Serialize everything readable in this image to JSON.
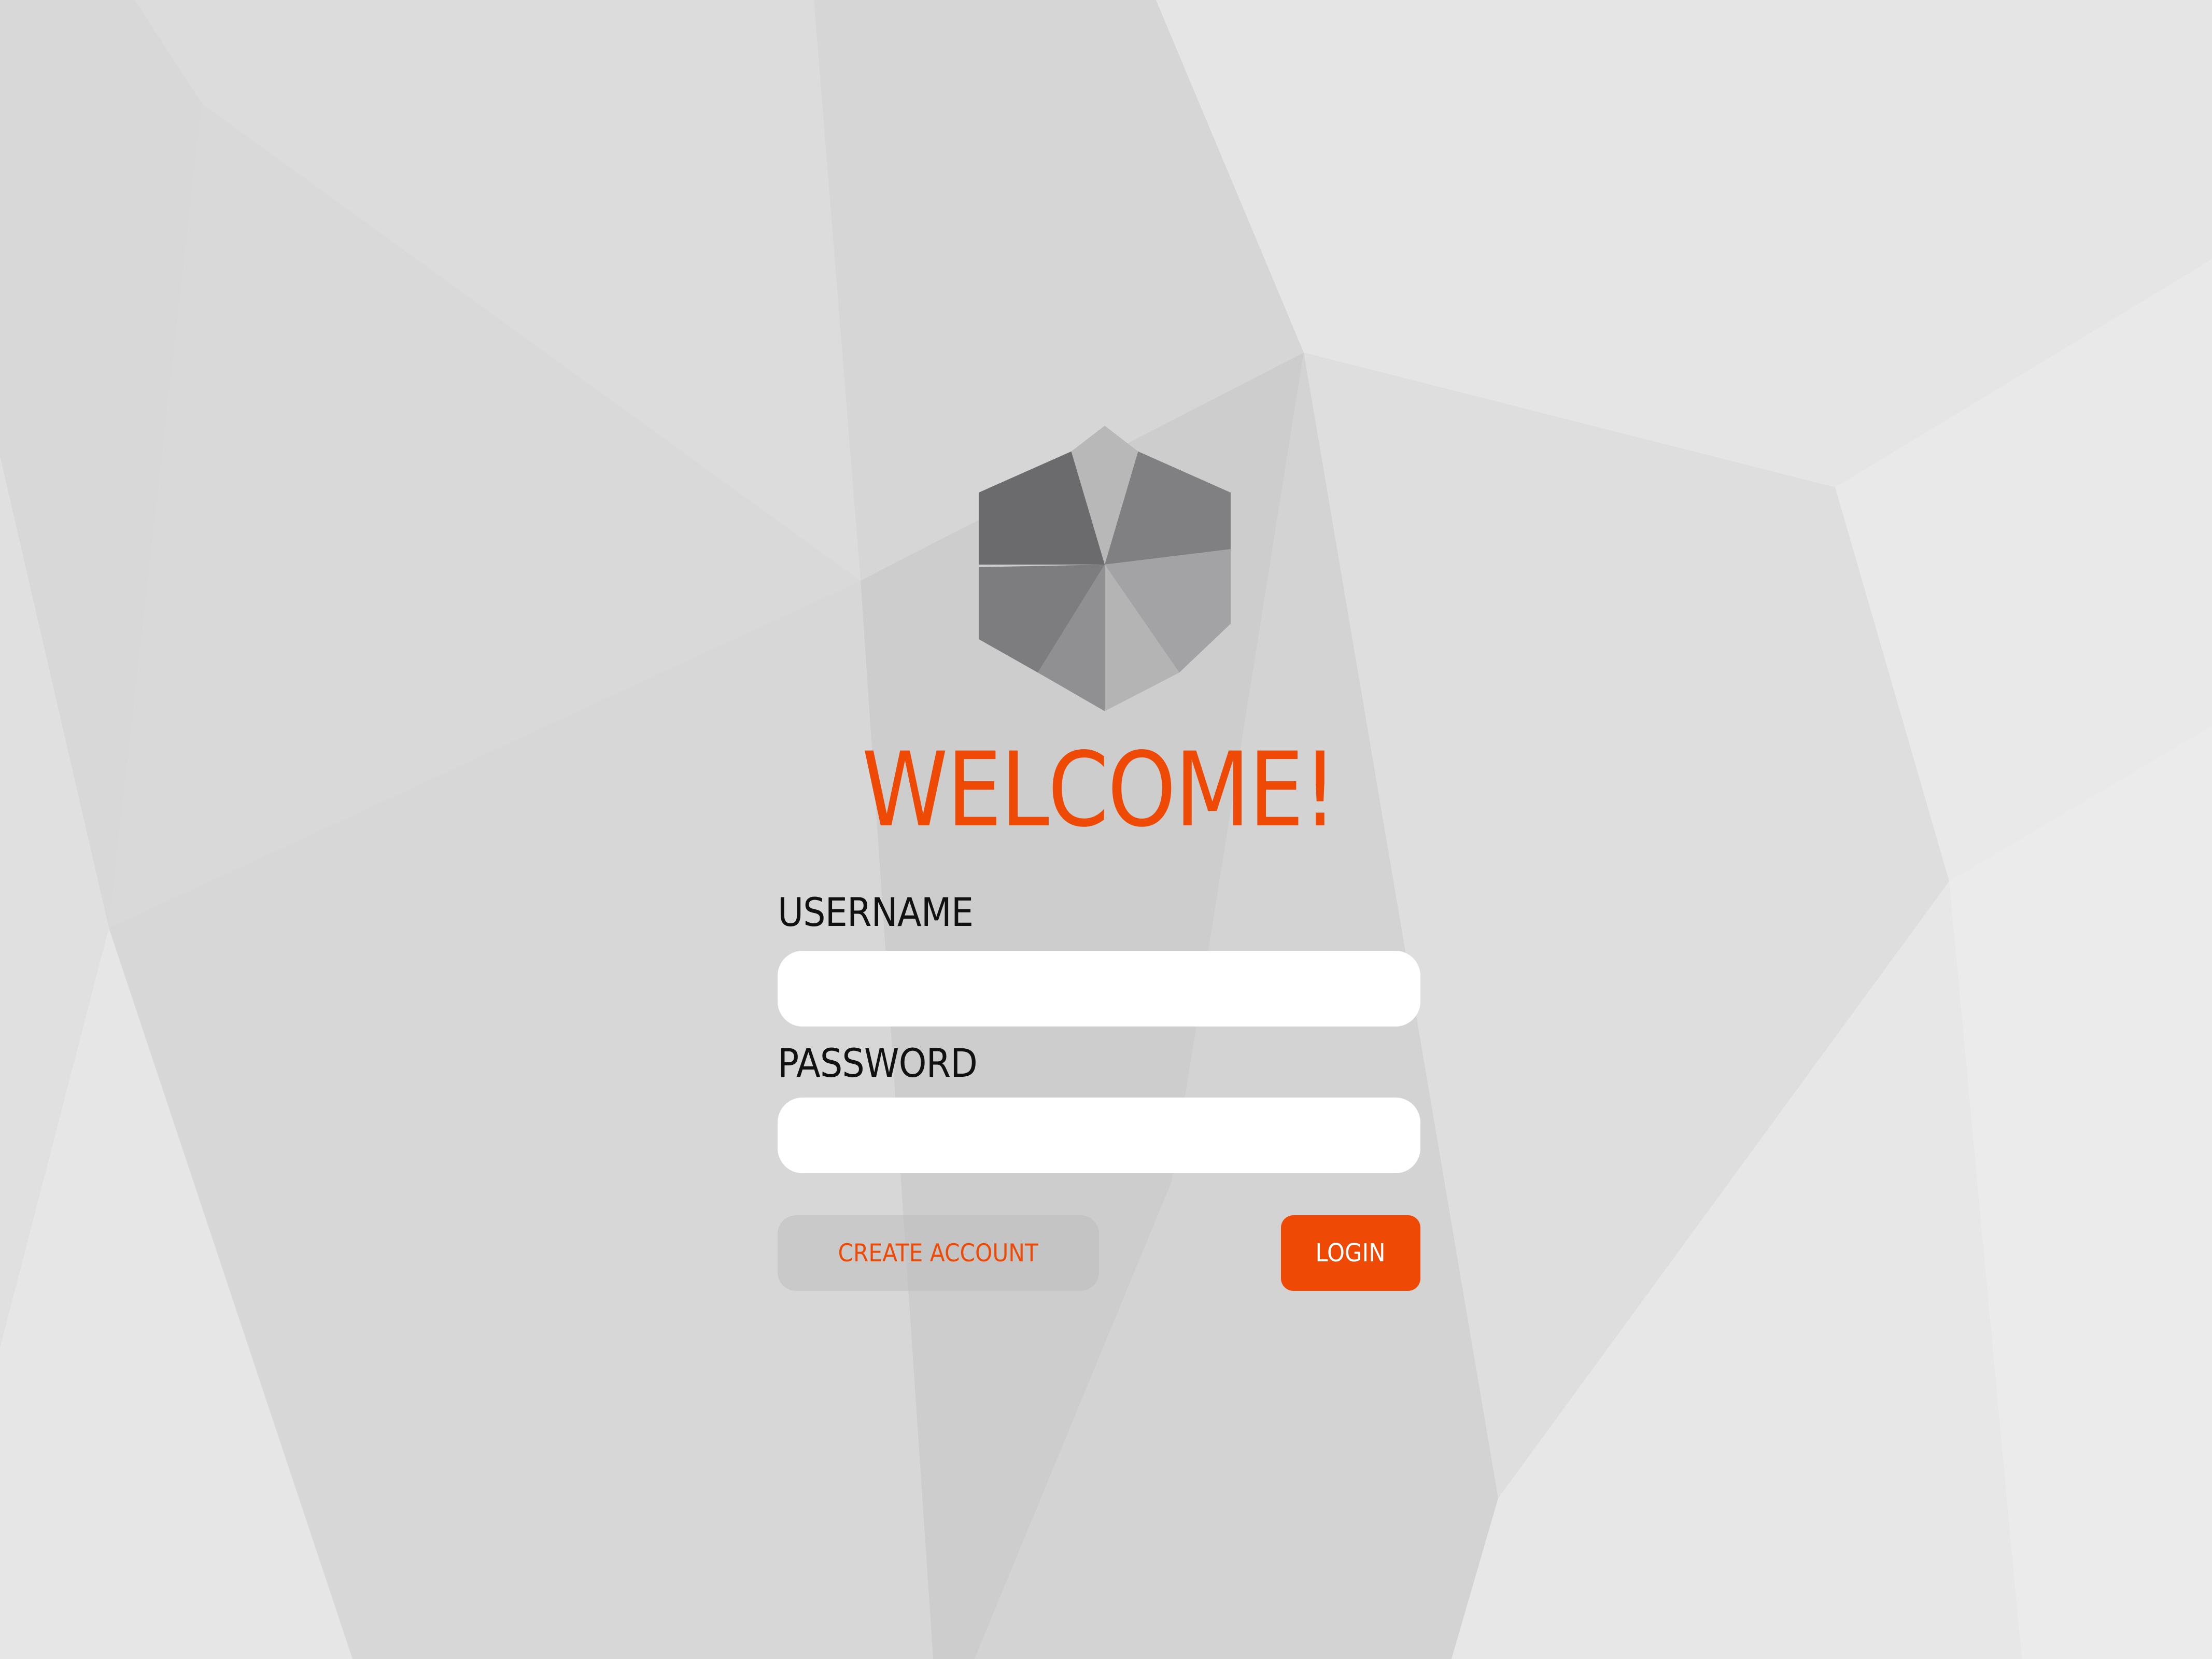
{
  "colors": {
    "accent": "#ee4a06",
    "background": "#e4e4e4",
    "field_background": "#ffffff",
    "label_text": "#111111",
    "secondary_button": "#cfcfcf"
  },
  "logo": {
    "icon": "hexagon-logo-icon"
  },
  "welcome": {
    "title": "WELCOME!"
  },
  "form": {
    "username_label": "USERNAME",
    "username_value": "",
    "password_label": "PASSWORD",
    "password_value": ""
  },
  "actions": {
    "create_account_label": "CREATE ACCOUNT",
    "login_label": "LOGIN"
  }
}
